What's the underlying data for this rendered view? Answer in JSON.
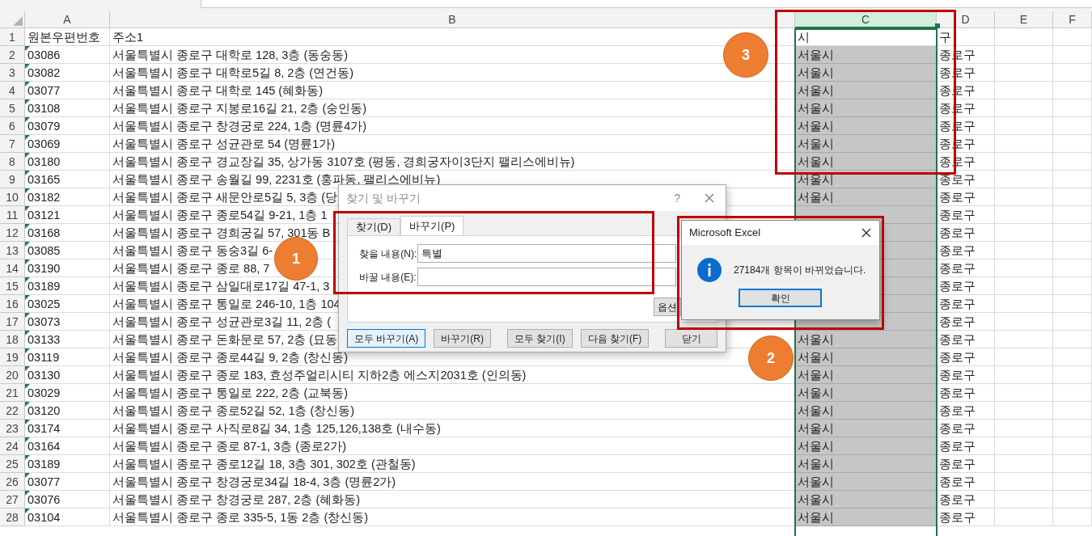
{
  "columns": [
    {
      "label": "A",
      "selected": false
    },
    {
      "label": "B",
      "selected": false
    },
    {
      "label": "C",
      "selected": true
    },
    {
      "label": "D",
      "selected": false
    },
    {
      "label": "E",
      "selected": false
    },
    {
      "label": "F",
      "selected": false
    }
  ],
  "rows": [
    {
      "number": "1",
      "error_marker": false,
      "active": true,
      "A": "원본우편번호",
      "B": "주소1",
      "C": "시",
      "D": "구"
    },
    {
      "number": "2",
      "error_marker": true,
      "active": false,
      "A": "03086",
      "B": "서울특별시 종로구 대학로 128, 3층 (동숭동)",
      "C": "서울시",
      "D": "종로구"
    },
    {
      "number": "3",
      "error_marker": true,
      "active": false,
      "A": "03082",
      "B": "서울특별시 종로구 대학로5길 8, 2층 (연건동)",
      "C": "서울시",
      "D": "종로구"
    },
    {
      "number": "4",
      "error_marker": true,
      "active": false,
      "A": "03077",
      "B": "서울특별시 종로구 대학로 145 (혜화동)",
      "C": "서울시",
      "D": "종로구"
    },
    {
      "number": "5",
      "error_marker": true,
      "active": false,
      "A": "03108",
      "B": "서울특별시 종로구 지봉로16길 21, 2층 (숭인동)",
      "C": "서울시",
      "D": "종로구"
    },
    {
      "number": "6",
      "error_marker": true,
      "active": false,
      "A": "03079",
      "B": "서울특별시 종로구 창경궁로 224, 1층 (명륜4가)",
      "C": "서울시",
      "D": "종로구"
    },
    {
      "number": "7",
      "error_marker": true,
      "active": false,
      "A": "03069",
      "B": "서울특별시 종로구 성균관로 54 (명륜1가)",
      "C": "서울시",
      "D": "종로구"
    },
    {
      "number": "8",
      "error_marker": true,
      "active": false,
      "A": "03180",
      "B": "서울특별시 종로구 경교장길 35, 상가동 3107호 (평동, 경희궁자이3단지 팰리스에비뉴)",
      "C": "서울시",
      "D": "종로구"
    },
    {
      "number": "9",
      "error_marker": true,
      "active": false,
      "A": "03165",
      "B": "서울특별시 종로구 송월길 99, 2231호 (홍파동, 팰리스에비뉴)",
      "C": "서울시",
      "D": "종로구"
    },
    {
      "number": "10",
      "error_marker": true,
      "active": false,
      "A": "03182",
      "B": "서울특별시 종로구 새문안로5길 5, 3층 (당",
      "C": "서울시",
      "D": "종로구"
    },
    {
      "number": "11",
      "error_marker": true,
      "active": false,
      "A": "03121",
      "B": "서울특별시 종로구 종로54길 9-21, 1층 1",
      "D": "종로구"
    },
    {
      "number": "12",
      "error_marker": true,
      "active": false,
      "A": "03168",
      "B": "서울특별시 종로구 경희궁길 57, 301동 B",
      "D": "종로구"
    },
    {
      "number": "13",
      "error_marker": true,
      "active": false,
      "A": "03085",
      "B": "서울특별시 종로구 동숭3길 6-",
      "D": "종로구"
    },
    {
      "number": "14",
      "error_marker": true,
      "active": false,
      "A": "03190",
      "B": "서울특별시 종로구 종로 88, 7",
      "D": "종로구"
    },
    {
      "number": "15",
      "error_marker": true,
      "active": false,
      "A": "03189",
      "B": "서울특별시 종로구 삼일대로17길 47-1, 3",
      "D": "종로구"
    },
    {
      "number": "16",
      "error_marker": true,
      "active": false,
      "A": "03025",
      "B": "서울특별시 종로구 통일로 246-10, 1층 104",
      "D": "종로구"
    },
    {
      "number": "17",
      "error_marker": true,
      "active": false,
      "A": "03073",
      "B": "서울특별시 종로구 성균관로3길 11, 2층 (",
      "D": "종로구"
    },
    {
      "number": "18",
      "error_marker": true,
      "active": false,
      "A": "03133",
      "B": "서울특별시 종로구 돈화문로 57, 2층 (묘동",
      "C": "서울시",
      "D": "종로구"
    },
    {
      "number": "19",
      "error_marker": true,
      "active": false,
      "A": "03119",
      "B": "서울특별시 종로구 종로44길 9, 2층 (창신동)",
      "C": "서울시",
      "D": "종로구"
    },
    {
      "number": "20",
      "error_marker": true,
      "active": false,
      "A": "03130",
      "B": "서울특별시 종로구 종로 183, 효성주얼리시티 지하2층 에스지2031호 (인의동)",
      "C": "서울시",
      "D": "종로구"
    },
    {
      "number": "21",
      "error_marker": true,
      "active": false,
      "A": "03029",
      "B": "서울특별시 종로구 통일로 222, 2층 (교북동)",
      "C": "서울시",
      "D": "종로구"
    },
    {
      "number": "22",
      "error_marker": true,
      "active": false,
      "A": "03120",
      "B": "서울특별시 종로구 종로52길 52, 1층 (창신동)",
      "C": "서울시",
      "D": "종로구"
    },
    {
      "number": "23",
      "error_marker": true,
      "active": false,
      "A": "03174",
      "B": "서울특별시 종로구 사직로8길 34, 1층 125,126,138호 (내수동)",
      "C": "서울시",
      "D": "종로구"
    },
    {
      "number": "24",
      "error_marker": true,
      "active": false,
      "A": "03164",
      "B": "서울특별시 종로구 종로 87-1, 3층 (종로2가)",
      "C": "서울시",
      "D": "종로구"
    },
    {
      "number": "25",
      "error_marker": true,
      "active": false,
      "A": "03189",
      "B": "서울특별시 종로구 종로12길 18, 3층 301, 302호 (관철동)",
      "C": "서울시",
      "D": "종로구"
    },
    {
      "number": "26",
      "error_marker": true,
      "active": false,
      "A": "03077",
      "B": "서울특별시 종로구 창경궁로34길 18-4, 3층 (명륜2가)",
      "C": "서울시",
      "D": "종로구"
    },
    {
      "number": "27",
      "error_marker": true,
      "active": false,
      "A": "03076",
      "B": "서울특별시 종로구 창경궁로 287, 2층 (혜화동)",
      "C": "서울시",
      "D": "종로구"
    },
    {
      "number": "28",
      "error_marker": true,
      "active": false,
      "A": "03104",
      "B": "서울특별시 종로구 종로 335-5, 1동 2층 (창신동)",
      "C": "서울시",
      "D": "종로구"
    }
  ],
  "find_replace_dialog": {
    "title": "찾기 및 바꾸기",
    "help": "?",
    "tabs": [
      {
        "label": "찾기(D)",
        "selected": false
      },
      {
        "label": "바꾸기(P)",
        "selected": true
      }
    ],
    "fields": [
      {
        "label": "찾을 내용(N):",
        "value": "특별"
      },
      {
        "label": "바꿀 내용(E):"
      }
    ],
    "options_button": "옵션",
    "buttons": [
      {
        "label": "모두 바꾸기(A)",
        "focused": true
      },
      {
        "label": "바꾸기(R)",
        "focused": false
      },
      {
        "label": "모두 찾기(I)",
        "focused": false
      },
      {
        "label": "다음 찾기(F)",
        "focused": false
      },
      {
        "label": "닫기",
        "focused": false
      }
    ]
  },
  "message_box": {
    "title": "Microsoft Excel",
    "message": "27184개 항목이 바뀌었습니다.",
    "button": "확인"
  },
  "annotations": [
    {
      "number": "1"
    },
    {
      "number": "2"
    },
    {
      "number": "3"
    }
  ]
}
